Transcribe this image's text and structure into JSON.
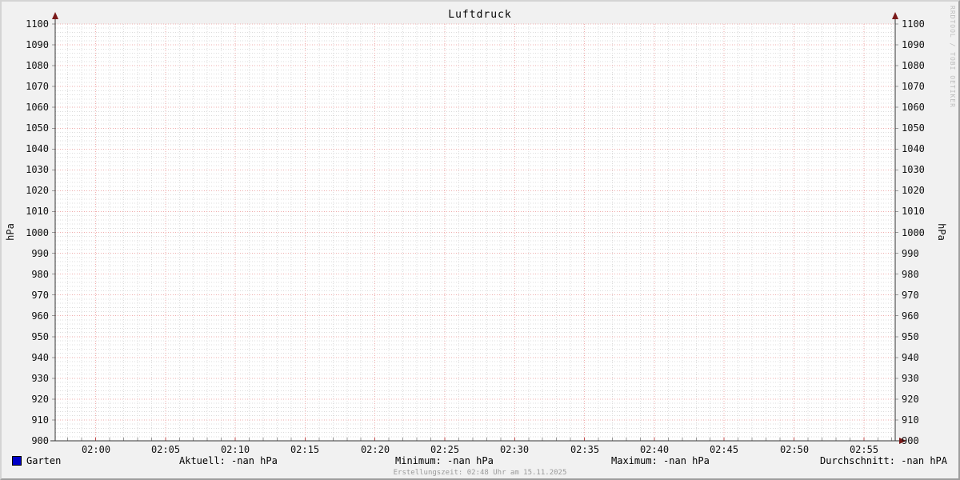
{
  "title": "Luftdruck",
  "watermark": "RRDTOOL / TOBI OETIKER",
  "axes": {
    "left_unit_label": "hPa",
    "right_unit_label": "hPa",
    "y_ticks": [
      "1100",
      "1090",
      "1080",
      "1070",
      "1060",
      "1050",
      "1040",
      "1030",
      "1020",
      "1010",
      "1000",
      "990",
      "980",
      "970",
      "960",
      "950",
      "940",
      "930",
      "920",
      "910",
      "900"
    ],
    "x_ticks": [
      "02:00",
      "02:05",
      "02:10",
      "02:15",
      "02:20",
      "02:25",
      "02:30",
      "02:35",
      "02:40",
      "02:45",
      "02:50",
      "02:55"
    ]
  },
  "legend": {
    "series_label": "Garten",
    "series_color": "#0000c8"
  },
  "stats": {
    "aktuell": "Aktuell: -nan hPa",
    "minimum": "Minimum: -nan hPa",
    "maximum": "Maximum: -nan hPa",
    "durchschnitt": "Durchschnitt: -nan hPA"
  },
  "footer": {
    "creation_time": "Erstellungszeit: 02:48 Uhr am 15.11.2025"
  },
  "colors": {
    "background": "#f1f1f1",
    "canvas": "#ffffff",
    "major_grid": "#efadad",
    "minor_grid": "#dcdcdc",
    "axis": "#333333",
    "arrow": "#7a1a1a",
    "major_tick": "#c05050",
    "minor_tick": "#999999",
    "series_blue": "#0000c8",
    "watermark_gray": "#bdbdbd"
  },
  "chart_data": {
    "type": "line",
    "title": "Luftdruck",
    "xlabel": "",
    "ylabel": "hPa",
    "ylabel_right": "hPa",
    "ylim": [
      900,
      1100
    ],
    "y_tick_step": 10,
    "x_tick_labels": [
      "02:00",
      "02:05",
      "02:10",
      "02:15",
      "02:20",
      "02:25",
      "02:30",
      "02:35",
      "02:40",
      "02:45",
      "02:50",
      "02:55"
    ],
    "x_minor_step_minutes": 1,
    "x_major_step_minutes": 5,
    "grid": true,
    "legend_position": "bottom",
    "series": [
      {
        "name": "Garten",
        "color": "#0000c8",
        "values": [],
        "current": "-nan hPa",
        "minimum": "-nan hPa",
        "maximum": "-nan hPa",
        "average": "-nan hPA"
      }
    ]
  }
}
